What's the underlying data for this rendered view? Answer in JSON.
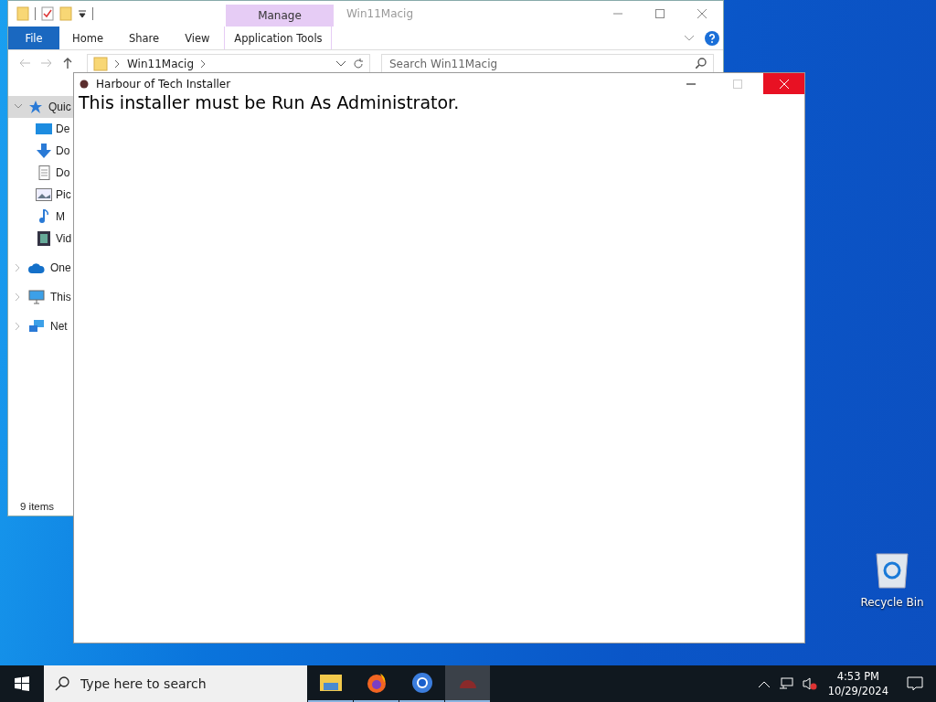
{
  "explorer": {
    "title": "Win11Macig",
    "context_group": "Manage",
    "tabs": [
      {
        "label": "File",
        "kind": "file",
        "selected": false
      },
      {
        "label": "Home",
        "kind": "plain",
        "selected": false
      },
      {
        "label": "Share",
        "kind": "plain",
        "selected": false
      },
      {
        "label": "View",
        "kind": "plain",
        "selected": false
      },
      {
        "label": "Application Tools",
        "kind": "context",
        "selected": false
      }
    ],
    "path": "Win11Macig",
    "search_placeholder": "Search Win11Macig",
    "nav": [
      {
        "label": "Quic",
        "kind": "star",
        "selected": true,
        "expanded": true,
        "children": [
          {
            "label": "De",
            "kind": "desktop",
            "selected": false
          },
          {
            "label": "Do",
            "kind": "download",
            "selected": false
          },
          {
            "label": "Do",
            "kind": "document",
            "selected": false
          },
          {
            "label": "Pic",
            "kind": "pictures",
            "selected": false
          },
          {
            "label": "M",
            "kind": "music",
            "selected": false
          },
          {
            "label": "Vid",
            "kind": "videos",
            "selected": false
          }
        ]
      },
      {
        "label": "One",
        "kind": "cloud",
        "selected": false,
        "expanded": false
      },
      {
        "label": "This",
        "kind": "pc",
        "selected": false,
        "expanded": false
      },
      {
        "label": "Net",
        "kind": "network",
        "selected": false,
        "expanded": false
      }
    ],
    "status": "9 items"
  },
  "installer": {
    "title": "Harbour of Tech Installer",
    "message": "This installer must be Run As Administrator."
  },
  "desktop_icons": [
    {
      "label": "Recycle Bin",
      "kind": "recycle"
    }
  ],
  "taskbar": {
    "search_placeholder": "Type here to search",
    "apps": [
      {
        "kind": "folder",
        "active": false
      },
      {
        "kind": "firefox",
        "active": false
      },
      {
        "kind": "chrome",
        "active": false
      },
      {
        "kind": "installer",
        "active": true
      }
    ],
    "time": "4:53 PM",
    "date": "10/29/2024"
  }
}
